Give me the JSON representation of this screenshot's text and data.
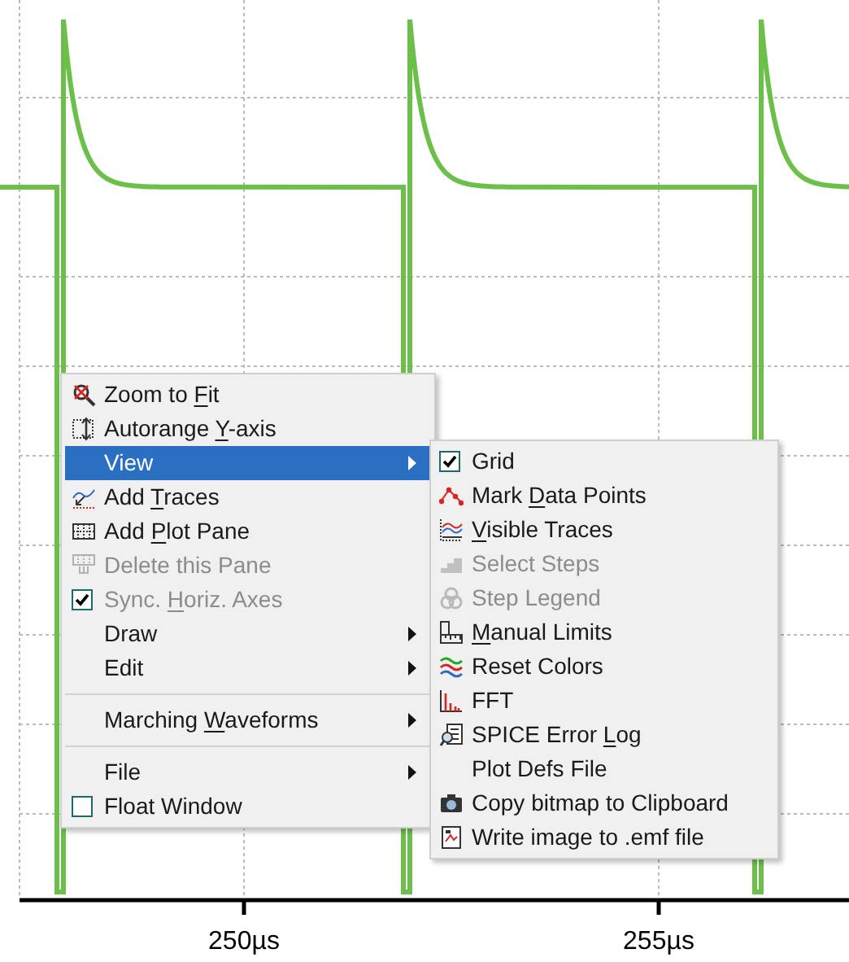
{
  "plot": {
    "x_axis": {
      "ticks": [
        "250µs",
        "255µs"
      ]
    }
  },
  "context_menu": {
    "groups": [
      {
        "items": [
          {
            "kind": "command",
            "label": "Zoom to ",
            "access_key": "F",
            "label_end": "it",
            "disabled": false,
            "selected": false
          },
          {
            "kind": "command",
            "label": "Autorange ",
            "access_key": "Y",
            "label_end": "-axis",
            "disabled": false,
            "selected": false
          },
          {
            "kind": "submenu",
            "label": "View",
            "disabled": false,
            "selected": true
          },
          {
            "kind": "command",
            "label": "Add ",
            "access_key": "T",
            "label_end": "races",
            "disabled": false,
            "selected": false
          },
          {
            "kind": "command",
            "label": "Add ",
            "access_key": "P",
            "label_end": "lot Pane",
            "disabled": false,
            "selected": false
          },
          {
            "kind": "command",
            "label": "Delete this Pane",
            "disabled": true,
            "selected": false
          },
          {
            "kind": "check",
            "label": "Sync. ",
            "access_key": "H",
            "label_end": "oriz. Axes",
            "checked": true,
            "disabled": true,
            "selected": false
          },
          {
            "kind": "submenu",
            "label": "Draw",
            "disabled": false,
            "selected": false
          },
          {
            "kind": "submenu",
            "label": "Edit",
            "disabled": false,
            "selected": false
          }
        ]
      },
      {
        "items": [
          {
            "kind": "submenu",
            "label": "Marching ",
            "access_key": "W",
            "label_end": "aveforms",
            "disabled": false,
            "selected": false
          }
        ]
      },
      {
        "items": [
          {
            "kind": "submenu",
            "label": "File",
            "disabled": false,
            "selected": false
          },
          {
            "kind": "check",
            "label": "Float Window",
            "checked": false,
            "disabled": false,
            "selected": false
          }
        ]
      }
    ]
  },
  "submenu": {
    "items": [
      {
        "kind": "check",
        "label": "Grid",
        "checked": true,
        "disabled": false
      },
      {
        "kind": "command",
        "label": "Mark ",
        "access_key": "D",
        "label_end": "ata Points",
        "disabled": false
      },
      {
        "kind": "command",
        "access_key": "V",
        "label_end": "isible Traces",
        "disabled": false
      },
      {
        "kind": "command",
        "label": "Select Steps",
        "disabled": true
      },
      {
        "kind": "command",
        "label": "Step Legend",
        "disabled": true
      },
      {
        "kind": "command",
        "access_key": "M",
        "label_end": "anual Limits",
        "disabled": false
      },
      {
        "kind": "command",
        "label": "Reset Colors",
        "disabled": false
      },
      {
        "kind": "command",
        "label": "FFT",
        "disabled": false
      },
      {
        "kind": "command",
        "label": "SPICE Error ",
        "access_key": "L",
        "label_end": "og",
        "disabled": false
      },
      {
        "kind": "command",
        "label": "Plot Defs File",
        "disabled": false
      },
      {
        "kind": "command",
        "label": "Copy bitmap to Clipboard",
        "disabled": false
      },
      {
        "kind": "command",
        "label": "Write image to .emf file",
        "disabled": false
      }
    ]
  }
}
